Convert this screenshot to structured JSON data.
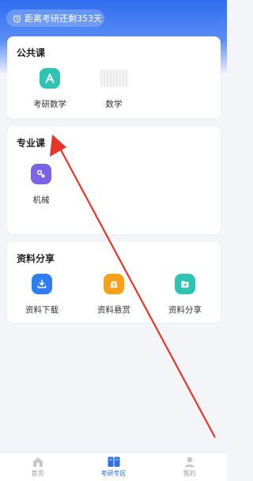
{
  "countdown": {
    "text": "距离考研还剩353天",
    "icon": "alarm-clock-icon"
  },
  "sections": [
    {
      "title": "公共课",
      "items": [
        {
          "label": "考研数学",
          "icon": "math-a-icon",
          "color": "#2fc4b2"
        },
        {
          "label": "数学",
          "icon": "image-placeholder"
        }
      ]
    },
    {
      "title": "专业课",
      "items": [
        {
          "label": "机械",
          "icon": "mechanical-icon",
          "color": "#7b63e8"
        }
      ]
    },
    {
      "title": "资料分享",
      "items": [
        {
          "label": "资料下载",
          "icon": "download-icon",
          "color": "#2f7cf0"
        },
        {
          "label": "资料悬赏",
          "icon": "reward-icon",
          "color": "#f5a11c"
        },
        {
          "label": "资料分享",
          "icon": "share-icon",
          "color": "#2fc4b2"
        }
      ]
    }
  ],
  "tabbar": [
    {
      "label": "首页",
      "icon": "home-icon",
      "active": false
    },
    {
      "label": "考研专区",
      "icon": "book-icon",
      "active": true
    },
    {
      "label": "我的",
      "icon": "user-icon",
      "active": false
    }
  ],
  "colors": {
    "primary": "#2f6ef0",
    "annotation_arrow": "#e8352a"
  }
}
